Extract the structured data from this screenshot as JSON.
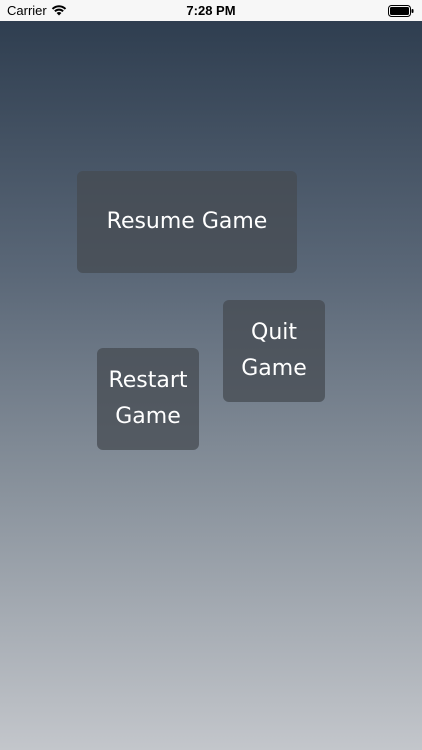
{
  "status_bar": {
    "carrier": "Carrier",
    "time": "7:28 PM",
    "wifi_icon": "wifi-icon",
    "battery_icon": "battery-icon"
  },
  "menu": {
    "resume_label": "Resume Game",
    "quit_line1": "Quit",
    "quit_line2": "Game",
    "restart_line1": "Restart",
    "restart_line2": "Game"
  },
  "colors": {
    "gradient_top": "#2f3e50",
    "gradient_bottom": "#c3c6cb",
    "button_bg": "#464b52",
    "button_text": "#ffffff"
  }
}
